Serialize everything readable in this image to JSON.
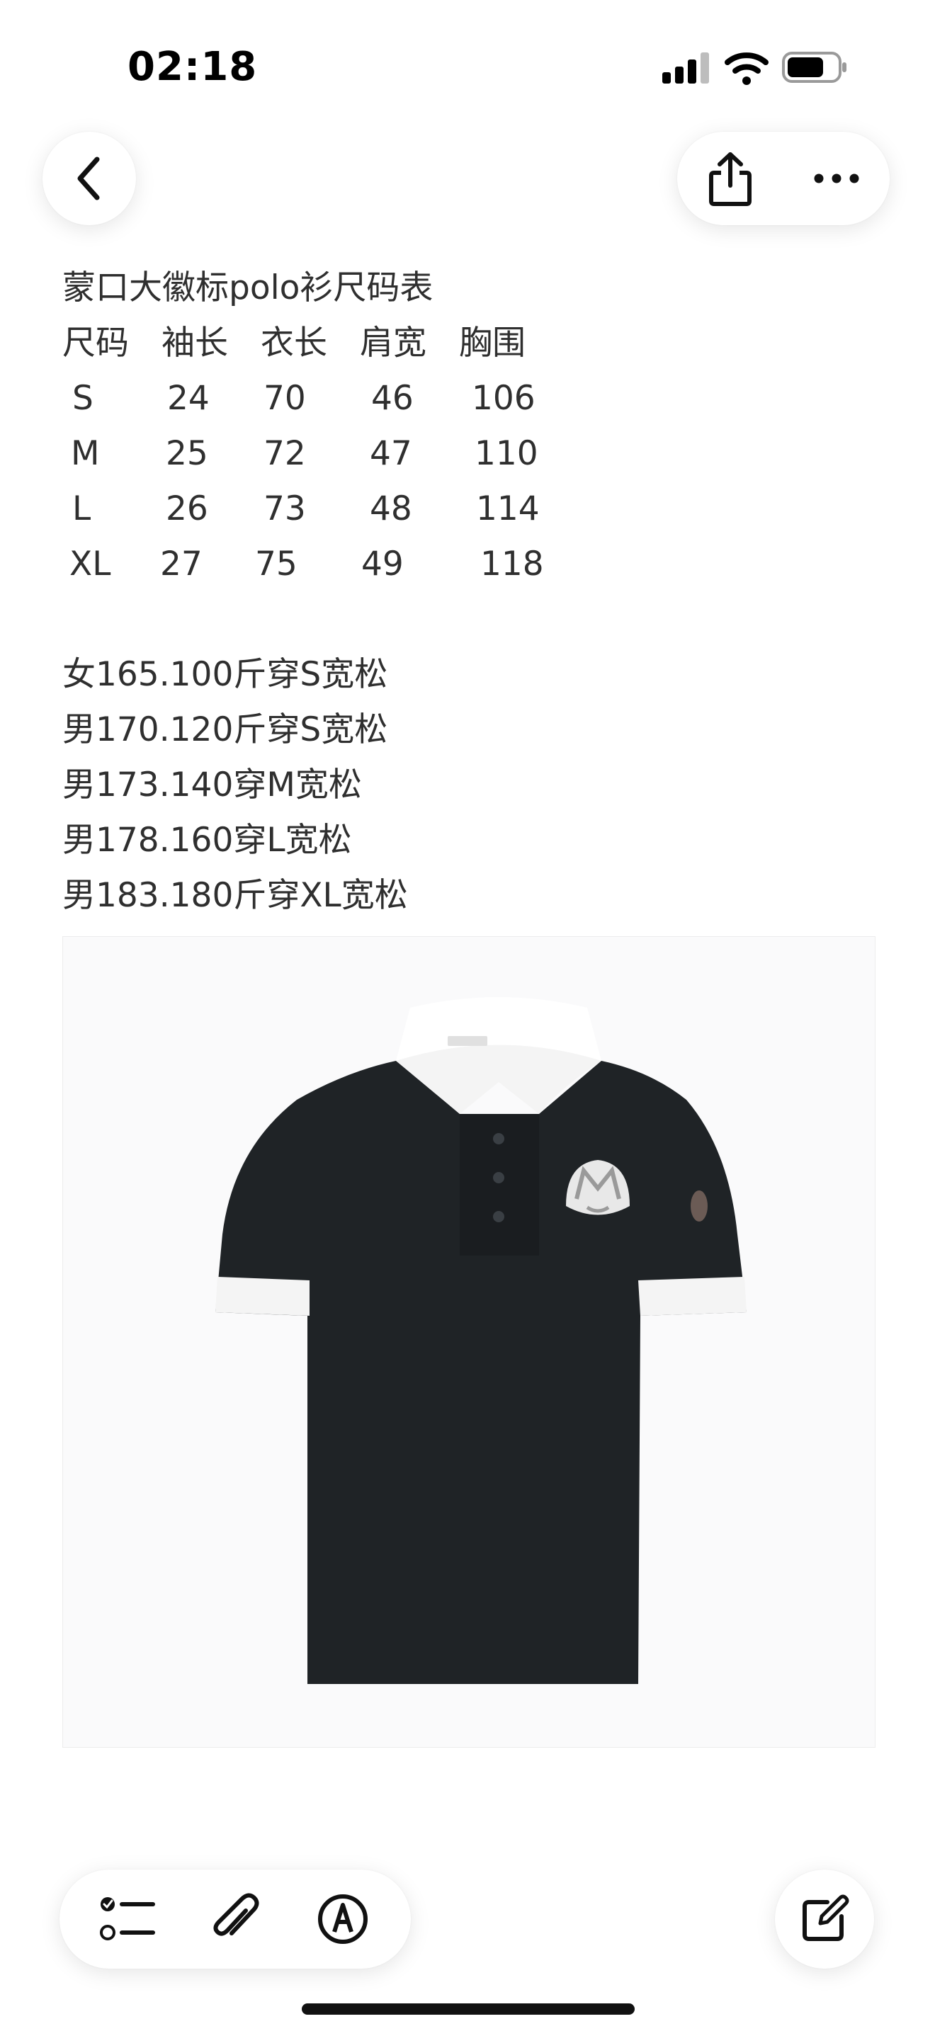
{
  "status_bar": {
    "time": "02:18"
  },
  "nav": {
    "back_icon": "chevron-left-icon",
    "share_icon": "share-icon",
    "more_icon": "ellipsis-icon"
  },
  "note": {
    "title": "蒙口大徽标polo衫尺码表",
    "size_table": {
      "headers": [
        "尺码",
        "袖长",
        "衣长",
        "肩宽",
        "胸围"
      ],
      "rows": [
        [
          "S",
          "24",
          "70",
          "46",
          "106"
        ],
        [
          "M",
          "25",
          "72",
          "47",
          "110"
        ],
        [
          "L",
          "26",
          "73",
          "48",
          "114"
        ],
        [
          "XL",
          "27",
          "75",
          "49",
          "118"
        ]
      ]
    },
    "recommendations": [
      "女165.100斤穿S宽松",
      "男170.120斤穿S宽松",
      "男173.140穿M宽松",
      "男178.160穿L宽松",
      "男183.180斤穿XL宽松"
    ]
  },
  "image": {
    "subject": "black-polo-shirt-white-collar-logo"
  },
  "bottom_bar": {
    "checklist_icon": "checklist-icon",
    "attach_icon": "paperclip-icon",
    "markup_icon": "markup-pen-icon",
    "compose_icon": "compose-icon"
  },
  "colors": {
    "background": "#ffffff",
    "text": "#2f2f2f",
    "shirt": "#1f2326",
    "trim": "#f4f4f4"
  }
}
